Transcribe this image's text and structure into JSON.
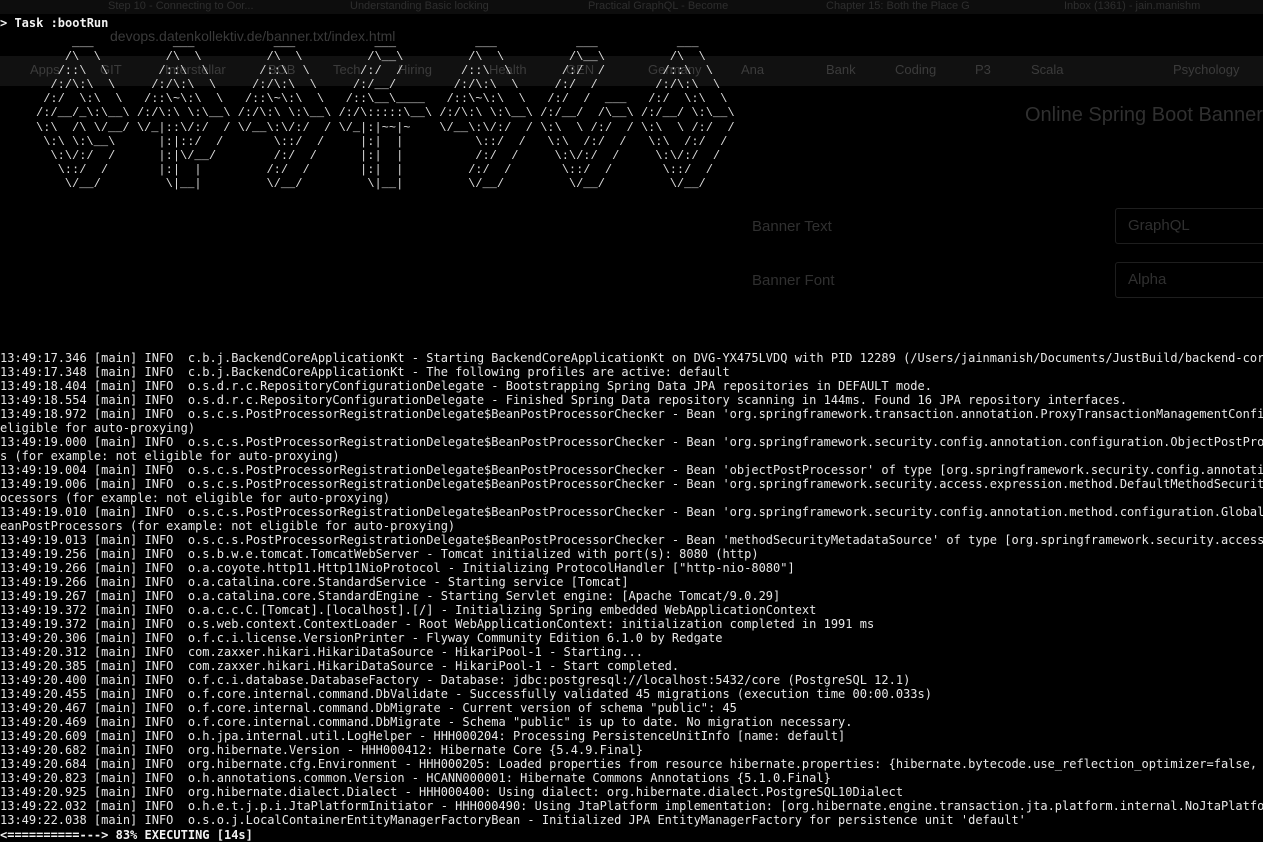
{
  "background_browser": {
    "tabs": [
      "Step 10 - Connecting to Oor...",
      "Understanding Basic locking",
      "Practical GraphQL - Become",
      "Chapter 15: Both the Place G",
      "Inbox (1361) - jain.manishm"
    ],
    "url": "devops.datenkollektiv.de/banner.txt/index.html",
    "bookmarks": [
      "Apps",
      "GIT",
      "Interstellar",
      "BOB",
      "Tech",
      "Hiring",
      "Health",
      "GEN",
      "Germany",
      "Ana",
      "Bank",
      "Coding",
      "P3",
      "Scala",
      "Psychology"
    ],
    "page_title": "Online Spring Boot Banner G",
    "fields": [
      {
        "label": "Banner Text",
        "value": "GraphQL"
      },
      {
        "label": "Banner Font",
        "value": "Alpha"
      }
    ]
  },
  "terminal": {
    "task_line": "> Task :bootRun",
    "banner": "          ___           ___           ___           ___           ___           ___           ___\n         /\\  \\         /\\  \\         /\\  \\         /\\__\\         /\\  \\         /\\__\\         /\\  \\\n        /::\\  \\       /::\\  \\       /::\\  \\       /:/  /        /::\\  \\       /:/  /        /::\\  \\\n       /:/\\:\\  \\     /:/\\:\\  \\     /:/\\:\\  \\     /:/__/        /:/\\:\\  \\     /:/  /        /:/\\:\\  \\\n      /:/  \\:\\  \\   /::\\~\\:\\  \\   /::\\~\\:\\  \\   /::\\__\\____   /::\\~\\:\\  \\   /:/  /  ___   /:/  \\:\\  \\\n     /:/__/_\\:\\__\\ /:/\\:\\ \\:\\__\\ /:/\\:\\ \\:\\__\\ /:/\\:::::\\__\\ /:/\\:\\ \\:\\__\\ /:/__/  /\\__\\ /:/__/ \\:\\__\\\n     \\:\\  /\\ \\/__/ \\/_|::\\/:/  / \\/__\\:\\/:/  / \\/_|:|~~|~    \\/__\\:\\/:/  / \\:\\  \\ /:/  / \\:\\  \\ /:/  /\n      \\:\\ \\:\\__\\      |:|::/  /       \\::/  /     |:|  |          \\::/  /   \\:\\  /:/  /   \\:\\  /:/  /\n       \\:\\/:/  /      |:|\\/__/        /:/  /      |:|  |          /:/  /     \\:\\/:/  /     \\:\\/:/  /\n        \\::/  /       |:|  |         /:/  /       |:|  |         /:/  /       \\::/  /       \\::/  /\n         \\/__/         \\|__|         \\/__/         \\|__|         \\/__/         \\/__/         \\/__/",
    "log_lines": [
      "13:49:17.346 [main] INFO  c.b.j.BackendCoreApplicationKt - Starting BackendCoreApplicationKt on DVG-YX475LVDQ with PID 12289 (/Users/jainmanish/Documents/JustBuild/backend-core/buil",
      "13:49:17.348 [main] INFO  c.b.j.BackendCoreApplicationKt - The following profiles are active: default",
      "13:49:18.404 [main] INFO  o.s.d.r.c.RepositoryConfigurationDelegate - Bootstrapping Spring Data JPA repositories in DEFAULT mode.",
      "13:49:18.554 [main] INFO  o.s.d.r.c.RepositoryConfigurationDelegate - Finished Spring Data repository scanning in 144ms. Found 16 JPA repository interfaces.",
      "13:49:18.972 [main] INFO  o.s.c.s.PostProcessorRegistrationDelegate$BeanPostProcessorChecker - Bean 'org.springframework.transaction.annotation.ProxyTransactionManagementConfigurati",
      "eligible for auto-proxying)",
      "13:49:19.000 [main] INFO  o.s.c.s.PostProcessorRegistrationDelegate$BeanPostProcessorChecker - Bean 'org.springframework.security.config.annotation.configuration.ObjectPostProcessor",
      "s (for example: not eligible for auto-proxying)",
      "13:49:19.004 [main] INFO  o.s.c.s.PostProcessorRegistrationDelegate$BeanPostProcessorChecker - Bean 'objectPostProcessor' of type [org.springframework.security.config.annotation.con",
      "13:49:19.006 [main] INFO  o.s.c.s.PostProcessorRegistrationDelegate$BeanPostProcessorChecker - Bean 'org.springframework.security.access.expression.method.DefaultMethodSecurityExpre",
      "ocessors (for example: not eligible for auto-proxying)",
      "13:49:19.010 [main] INFO  o.s.c.s.PostProcessorRegistrationDelegate$BeanPostProcessorChecker - Bean 'org.springframework.security.config.annotation.method.configuration.GlobalMetho",
      "eanPostProcessors (for example: not eligible for auto-proxying)",
      "13:49:19.013 [main] INFO  o.s.c.s.PostProcessorRegistrationDelegate$BeanPostProcessorChecker - Bean 'methodSecurityMetadataSource' of type [org.springframework.security.access.metho",
      "13:49:19.256 [main] INFO  o.s.b.w.e.tomcat.TomcatWebServer - Tomcat initialized with port(s): 8080 (http)",
      "13:49:19.266 [main] INFO  o.a.coyote.http11.Http11NioProtocol - Initializing ProtocolHandler [\"http-nio-8080\"]",
      "13:49:19.266 [main] INFO  o.a.catalina.core.StandardService - Starting service [Tomcat]",
      "13:49:19.267 [main] INFO  o.a.catalina.core.StandardEngine - Starting Servlet engine: [Apache Tomcat/9.0.29]",
      "13:49:19.372 [main] INFO  o.a.c.c.C.[Tomcat].[localhost].[/] - Initializing Spring embedded WebApplicationContext",
      "13:49:19.372 [main] INFO  o.s.web.context.ContextLoader - Root WebApplicationContext: initialization completed in 1991 ms",
      "13:49:20.306 [main] INFO  o.f.c.i.license.VersionPrinter - Flyway Community Edition 6.1.0 by Redgate",
      "13:49:20.312 [main] INFO  com.zaxxer.hikari.HikariDataSource - HikariPool-1 - Starting...",
      "13:49:20.385 [main] INFO  com.zaxxer.hikari.HikariDataSource - HikariPool-1 - Start completed.",
      "13:49:20.400 [main] INFO  o.f.c.i.database.DatabaseFactory - Database: jdbc:postgresql://localhost:5432/core (PostgreSQL 12.1)",
      "13:49:20.455 [main] INFO  o.f.core.internal.command.DbValidate - Successfully validated 45 migrations (execution time 00:00.033s)",
      "13:49:20.467 [main] INFO  o.f.core.internal.command.DbMigrate - Current version of schema \"public\": 45",
      "13:49:20.469 [main] INFO  o.f.core.internal.command.DbMigrate - Schema \"public\" is up to date. No migration necessary.",
      "13:49:20.609 [main] INFO  o.h.jpa.internal.util.LogHelper - HHH000204: Processing PersistenceUnitInfo [name: default]",
      "13:49:20.682 [main] INFO  org.hibernate.Version - HHH000412: Hibernate Core {5.4.9.Final}",
      "13:49:20.684 [main] INFO  org.hibernate.cfg.Environment - HHH000205: Loaded properties from resource hibernate.properties: {hibernate.bytecode.use_reflection_optimizer=false, hiberr",
      "13:49:20.823 [main] INFO  o.h.annotations.common.Version - HCANN000001: Hibernate Commons Annotations {5.1.0.Final}",
      "13:49:20.925 [main] INFO  org.hibernate.dialect.Dialect - HHH000400: Using dialect: org.hibernate.dialect.PostgreSQL10Dialect",
      "13:49:22.032 [main] INFO  o.h.e.t.j.p.i.JtaPlatformInitiator - HHH000490: Using JtaPlatform implementation: [org.hibernate.engine.transaction.jta.platform.internal.NoJtaPlatform]",
      "13:49:22.038 [main] INFO  o.s.o.j.LocalContainerEntityManagerFactoryBean - Initialized JPA EntityManagerFactory for persistence unit 'default'"
    ],
    "status_line": "<==========---> 83% EXECUTING [14s]"
  },
  "colors": {
    "background": "#000000",
    "text": "#e8e8e8"
  }
}
